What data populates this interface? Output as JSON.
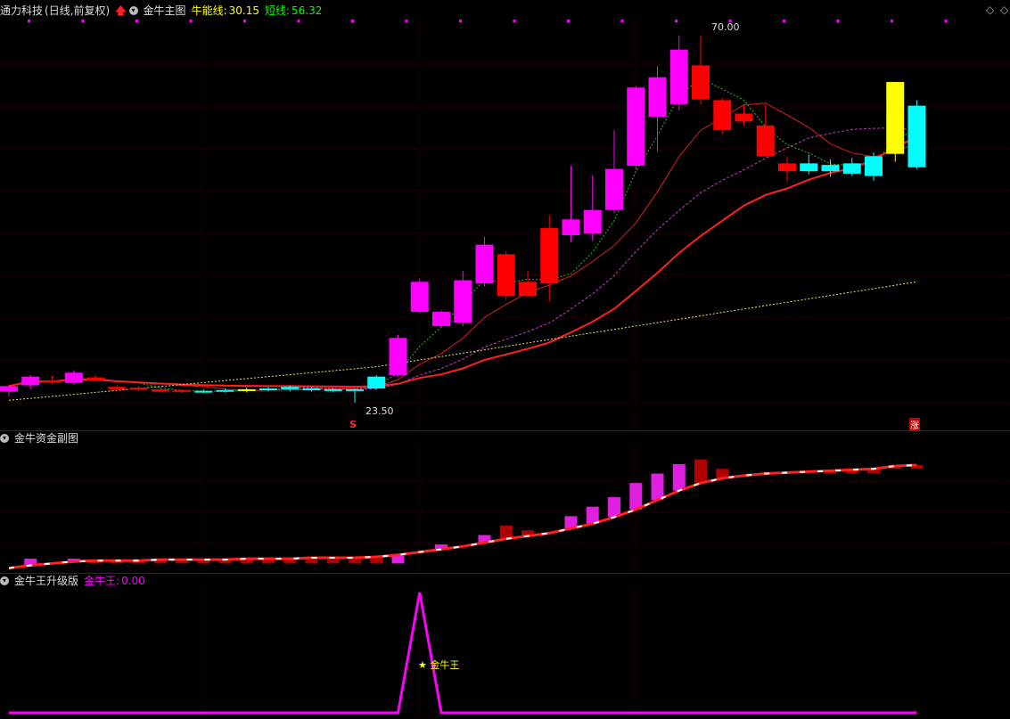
{
  "header": {
    "stock_name": "通力科技",
    "period": "(日线,前复权)",
    "indicator": "金牛主图",
    "line1_label": "牛能线:",
    "line1_value": "30.15",
    "line2_label": "短线:",
    "line2_value": "56.32"
  },
  "pane2": {
    "title": "金牛资金副图"
  },
  "pane3": {
    "title": "金牛王升级版",
    "value_label": "金牛王:",
    "value": "0.00"
  },
  "annotations": {
    "high_price": "70.00",
    "low_price": "23.50",
    "signal_s": "S",
    "signal_zhang": "涨",
    "star_label": "★ 金牛王"
  },
  "colors": {
    "up_magenta": "#ff00ff",
    "down_red": "#ff0000",
    "cyan": "#00ffff",
    "yellow": "#ffff00",
    "grid": "#5a0000"
  },
  "chart_data": [
    {
      "type": "candlestick",
      "title": "金牛主图",
      "ylim": [
        20,
        72
      ],
      "candles": [
        {
          "o": 24.9,
          "h": 25.8,
          "l": 24.3,
          "c": 25.6,
          "col": "magenta"
        },
        {
          "o": 25.7,
          "h": 27.0,
          "l": 25.2,
          "c": 26.8,
          "col": "magenta"
        },
        {
          "o": 26.3,
          "h": 26.9,
          "l": 25.9,
          "c": 26.1,
          "col": "red"
        },
        {
          "o": 26.0,
          "h": 27.6,
          "l": 25.8,
          "c": 27.3,
          "col": "magenta"
        },
        {
          "o": 26.7,
          "h": 27.0,
          "l": 26.2,
          "c": 26.3,
          "col": "red"
        },
        {
          "o": 25.5,
          "h": 25.7,
          "l": 25.0,
          "c": 25.2,
          "col": "red"
        },
        {
          "o": 25.4,
          "h": 25.6,
          "l": 24.9,
          "c": 25.2,
          "col": "red"
        },
        {
          "o": 25.2,
          "h": 25.4,
          "l": 24.8,
          "c": 24.9,
          "col": "red"
        },
        {
          "o": 25.1,
          "h": 25.2,
          "l": 24.7,
          "c": 24.9,
          "col": "red"
        },
        {
          "o": 25.0,
          "h": 25.2,
          "l": 24.7,
          "c": 24.9,
          "col": "cyan"
        },
        {
          "o": 25.0,
          "h": 25.3,
          "l": 24.8,
          "c": 25.1,
          "col": "cyan"
        },
        {
          "o": 25.1,
          "h": 25.4,
          "l": 24.8,
          "c": 25.2,
          "col": "yellow"
        },
        {
          "o": 25.1,
          "h": 25.5,
          "l": 24.9,
          "c": 25.3,
          "col": "cyan"
        },
        {
          "o": 25.2,
          "h": 25.7,
          "l": 24.9,
          "c": 25.5,
          "col": "cyan"
        },
        {
          "o": 25.2,
          "h": 25.5,
          "l": 24.9,
          "c": 25.3,
          "col": "cyan"
        },
        {
          "o": 25.1,
          "h": 25.4,
          "l": 24.8,
          "c": 25.2,
          "col": "cyan"
        },
        {
          "o": 25.1,
          "h": 25.3,
          "l": 23.5,
          "c": 25.2,
          "col": "cyan"
        },
        {
          "o": 25.3,
          "h": 27.0,
          "l": 25.1,
          "c": 26.8,
          "col": "cyan"
        },
        {
          "o": 27.0,
          "h": 32.1,
          "l": 26.8,
          "c": 31.7,
          "col": "magenta"
        },
        {
          "o": 35.0,
          "h": 39.2,
          "l": 34.8,
          "c": 38.8,
          "col": "magenta"
        },
        {
          "o": 33.2,
          "h": 35.2,
          "l": 33.0,
          "c": 35.0,
          "col": "magenta"
        },
        {
          "o": 33.6,
          "h": 40.2,
          "l": 33.2,
          "c": 39.0,
          "col": "magenta"
        },
        {
          "o": 38.6,
          "h": 44.5,
          "l": 38.2,
          "c": 43.5,
          "col": "magenta"
        },
        {
          "o": 42.3,
          "h": 42.7,
          "l": 36.5,
          "c": 37.0,
          "col": "red"
        },
        {
          "o": 38.8,
          "h": 40.2,
          "l": 36.8,
          "c": 37.0,
          "col": "red"
        },
        {
          "o": 45.6,
          "h": 47.2,
          "l": 36.3,
          "c": 38.6,
          "col": "red"
        },
        {
          "o": 44.7,
          "h": 53.5,
          "l": 43.8,
          "c": 46.7,
          "col": "magenta"
        },
        {
          "o": 44.9,
          "h": 52.3,
          "l": 44.0,
          "c": 47.9,
          "col": "magenta"
        },
        {
          "o": 47.9,
          "h": 58.0,
          "l": 47.5,
          "c": 53.1,
          "col": "magenta"
        },
        {
          "o": 53.5,
          "h": 63.6,
          "l": 53.0,
          "c": 63.4,
          "col": "magenta"
        },
        {
          "o": 59.7,
          "h": 66.1,
          "l": 55.3,
          "c": 64.7,
          "col": "magenta"
        },
        {
          "o": 61.3,
          "h": 70.0,
          "l": 60.5,
          "c": 68.2,
          "col": "magenta"
        },
        {
          "o": 66.2,
          "h": 70.0,
          "l": 61.2,
          "c": 61.9,
          "col": "red"
        },
        {
          "o": 61.8,
          "h": 62.1,
          "l": 57.5,
          "c": 58.0,
          "col": "red"
        },
        {
          "o": 60.1,
          "h": 61.3,
          "l": 58.6,
          "c": 59.1,
          "col": "red"
        },
        {
          "o": 58.6,
          "h": 61.3,
          "l": 54.7,
          "c": 54.7,
          "col": "red"
        },
        {
          "o": 53.8,
          "h": 54.7,
          "l": 51.5,
          "c": 52.8,
          "col": "red"
        },
        {
          "o": 52.8,
          "h": 54.9,
          "l": 52.4,
          "c": 53.8,
          "col": "cyan"
        },
        {
          "o": 52.8,
          "h": 54.3,
          "l": 52.1,
          "c": 53.6,
          "col": "cyan"
        },
        {
          "o": 52.5,
          "h": 54.5,
          "l": 52.2,
          "c": 53.8,
          "col": "cyan"
        },
        {
          "o": 52.2,
          "h": 55.2,
          "l": 51.6,
          "c": 54.7,
          "col": "cyan"
        },
        {
          "o": 55.0,
          "h": 64.1,
          "l": 54.0,
          "c": 64.1,
          "col": "yellow"
        },
        {
          "o": 53.3,
          "h": 61.8,
          "l": 53.1,
          "c": 61.1,
          "col": "cyan"
        }
      ]
    },
    {
      "type": "bar",
      "title": "金牛资金副图",
      "values": [
        0.5,
        1.5,
        1.0,
        1.5,
        1.0,
        1.0,
        1.0,
        1.0,
        1.0,
        1.0,
        1.0,
        1.0,
        1.0,
        1.0,
        1.0,
        1.0,
        1.0,
        1.0,
        1.0,
        2.5,
        3.0,
        3.0,
        4.0,
        5.0,
        4.5,
        4.5,
        6.0,
        7.0,
        8.0,
        9.5,
        10.5,
        11.5,
        12.0,
        11.0,
        10.5,
        10.5,
        10.5,
        10.5,
        10.5,
        10.5,
        10.5,
        11.0,
        11.0
      ],
      "line": [
        0.5,
        0.8,
        1.0,
        1.2,
        1.3,
        1.3,
        1.3,
        1.4,
        1.4,
        1.4,
        1.4,
        1.5,
        1.5,
        1.5,
        1.6,
        1.6,
        1.6,
        1.7,
        1.9,
        2.2,
        2.5,
        2.8,
        3.2,
        3.6,
        3.9,
        4.2,
        4.7,
        5.2,
        5.9,
        6.7,
        7.7,
        8.7,
        9.5,
        10.0,
        10.3,
        10.5,
        10.6,
        10.7,
        10.8,
        10.9,
        11.0,
        11.3,
        11.4
      ],
      "ylim": [
        0,
        13
      ]
    },
    {
      "type": "line",
      "title": "金牛王升级版",
      "series": [
        {
          "name": "金牛王",
          "values": [
            0,
            0,
            0,
            0,
            0,
            0,
            0,
            0,
            0,
            0,
            0,
            0,
            0,
            0,
            0,
            0,
            0,
            0,
            0,
            1,
            0,
            0,
            0,
            0,
            0,
            0,
            0,
            0,
            0,
            0,
            0,
            0,
            0,
            0,
            0,
            0,
            0,
            0,
            0,
            0,
            0,
            0,
            0
          ]
        }
      ],
      "ylim": [
        0,
        1
      ]
    }
  ]
}
